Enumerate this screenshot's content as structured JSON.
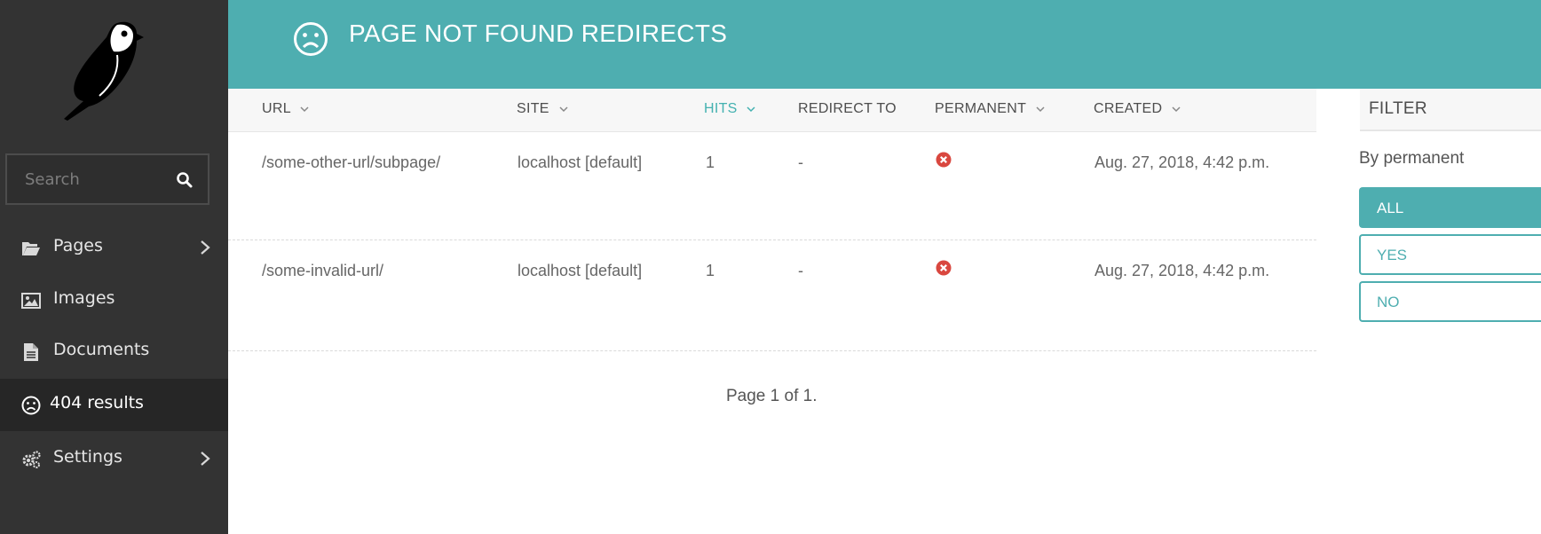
{
  "sidebar": {
    "search_placeholder": "Search",
    "items": [
      {
        "label": "Pages",
        "icon": "folder-open-icon",
        "has_submenu": true
      },
      {
        "label": "Images",
        "icon": "image-icon",
        "has_submenu": false
      },
      {
        "label": "Documents",
        "icon": "document-icon",
        "has_submenu": false
      },
      {
        "label": "404 results",
        "icon": "sad-face-icon",
        "has_submenu": false,
        "active": true
      },
      {
        "label": "Settings",
        "icon": "cogs-icon",
        "has_submenu": true
      }
    ]
  },
  "header": {
    "title": "PAGE NOT FOUND REDIRECTS",
    "icon": "sad-face-icon"
  },
  "table": {
    "columns": [
      "URL",
      "SITE",
      "HITS",
      "REDIRECT TO",
      "PERMANENT",
      "CREATED"
    ],
    "sorted_column": "HITS",
    "rows": [
      {
        "url": "/some-other-url/subpage/",
        "site": "localhost [default]",
        "hits": "1",
        "redirect_to": "-",
        "permanent": false,
        "created": "Aug. 27, 2018, 4:42 p.m."
      },
      {
        "url": "/some-invalid-url/",
        "site": "localhost [default]",
        "hits": "1",
        "redirect_to": "-",
        "permanent": false,
        "created": "Aug. 27, 2018, 4:42 p.m."
      }
    ]
  },
  "pagination": {
    "text": "Page 1 of 1."
  },
  "filter": {
    "title": "FILTER",
    "subtitle": "By permanent",
    "options": [
      "ALL",
      "YES",
      "NO"
    ],
    "selected": "ALL"
  },
  "colors": {
    "accent": "#4eaeb0",
    "sidebar_bg": "#333333",
    "error_red": "#d9473f"
  }
}
